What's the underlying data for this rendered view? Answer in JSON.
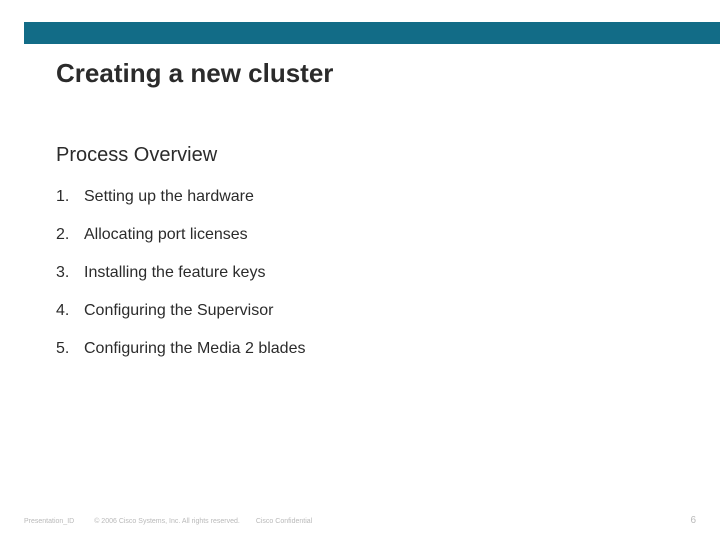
{
  "colors": {
    "bar": "#126c87"
  },
  "title": "Creating a new cluster",
  "subtitle": "Process Overview",
  "steps": [
    {
      "n": "1.",
      "text": "Setting up the hardware"
    },
    {
      "n": "2.",
      "text": "Allocating port licenses"
    },
    {
      "n": "3.",
      "text": "Installing the feature keys"
    },
    {
      "n": "4.",
      "text": "Configuring the Supervisor"
    },
    {
      "n": "5.",
      "text": "Configuring the Media 2 blades"
    }
  ],
  "footer": {
    "presentation_id": "Presentation_ID",
    "copyright": "© 2006 Cisco Systems, Inc. All rights reserved.",
    "confidential": "Cisco Confidential",
    "page": "6"
  }
}
